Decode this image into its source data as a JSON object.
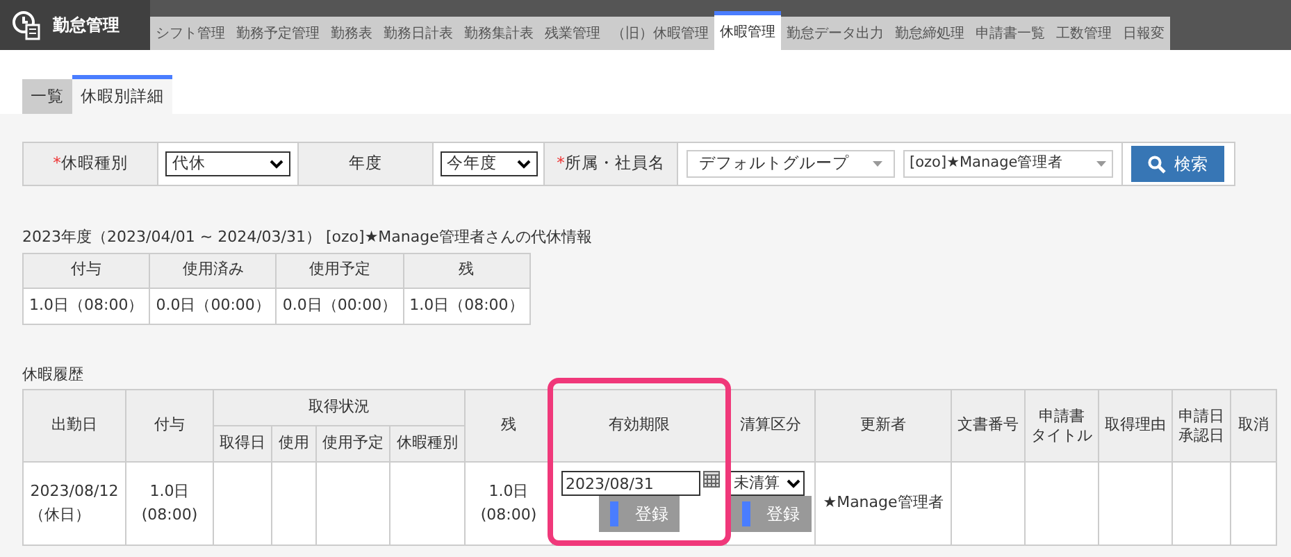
{
  "app": {
    "title": "勤怠管理"
  },
  "nav_tabs": [
    {
      "label": "シフト管理",
      "selected": false
    },
    {
      "label": "勤務予定管理",
      "selected": false
    },
    {
      "label": "勤務表",
      "selected": false
    },
    {
      "label": "勤務日計表",
      "selected": false
    },
    {
      "label": "勤務集計表",
      "selected": false
    },
    {
      "label": "残業管理",
      "selected": false
    },
    {
      "label": "（旧）休暇管理",
      "selected": false
    },
    {
      "label": "休暇管理",
      "selected": true
    },
    {
      "label": "勤怠データ出力",
      "selected": false
    },
    {
      "label": "勤怠締処理",
      "selected": false
    },
    {
      "label": "申請書一覧",
      "selected": false
    },
    {
      "label": "工数管理",
      "selected": false
    },
    {
      "label": "日報変",
      "selected": false
    }
  ],
  "sub_tabs": [
    {
      "label": "一覧",
      "selected": false
    },
    {
      "label": "休暇別詳細",
      "selected": true
    }
  ],
  "filter": {
    "leave_type_label": "休暇種別",
    "required_mark": "*",
    "leave_type_value": "代休",
    "year_label": "年度",
    "year_value": "今年度",
    "dept_label": "所属・社員名",
    "group_value": "デフォルトグループ",
    "employee_value": "[ozo]★Manage管理者",
    "search_button": "検索"
  },
  "summary": {
    "heading": "2023年度（2023/04/01 ~ 2024/03/31） [ozo]★Manage管理者さんの代休情報",
    "columns": [
      "付与",
      "使用済み",
      "使用予定",
      "残"
    ],
    "values": [
      "1.0日（08:00）",
      "0.0日（00:00）",
      "0.0日（00:00）",
      "1.0日（08:00）"
    ]
  },
  "history": {
    "heading": "休暇履歴",
    "columns": {
      "date": "出勤日",
      "grant": "付与",
      "status": "取得状況",
      "status_sub": [
        "取得日",
        "使用",
        "使用予定",
        "休暇種別"
      ],
      "remaining": "残",
      "expiry": "有効期限",
      "settlement": "清算区分",
      "updater": "更新者",
      "doc_no": "文書番号",
      "app_title": [
        "申請書",
        "タイトル"
      ],
      "reason": "取得理由",
      "dates": [
        "申請日",
        "承認日"
      ],
      "cancel": "取消"
    },
    "rows": [
      {
        "date": "2023/08/12",
        "day_note": "（休日）",
        "grant": "1.0日",
        "grant_time": "(08:00)",
        "remaining": "1.0日",
        "remaining_time": "(08:00)",
        "expiry": "2023/08/31",
        "expiry_button": "登録",
        "settlement": "未清算",
        "settlement_button": "登録",
        "updater": "★Manage管理者"
      }
    ],
    "highlight_expiry": true
  }
}
